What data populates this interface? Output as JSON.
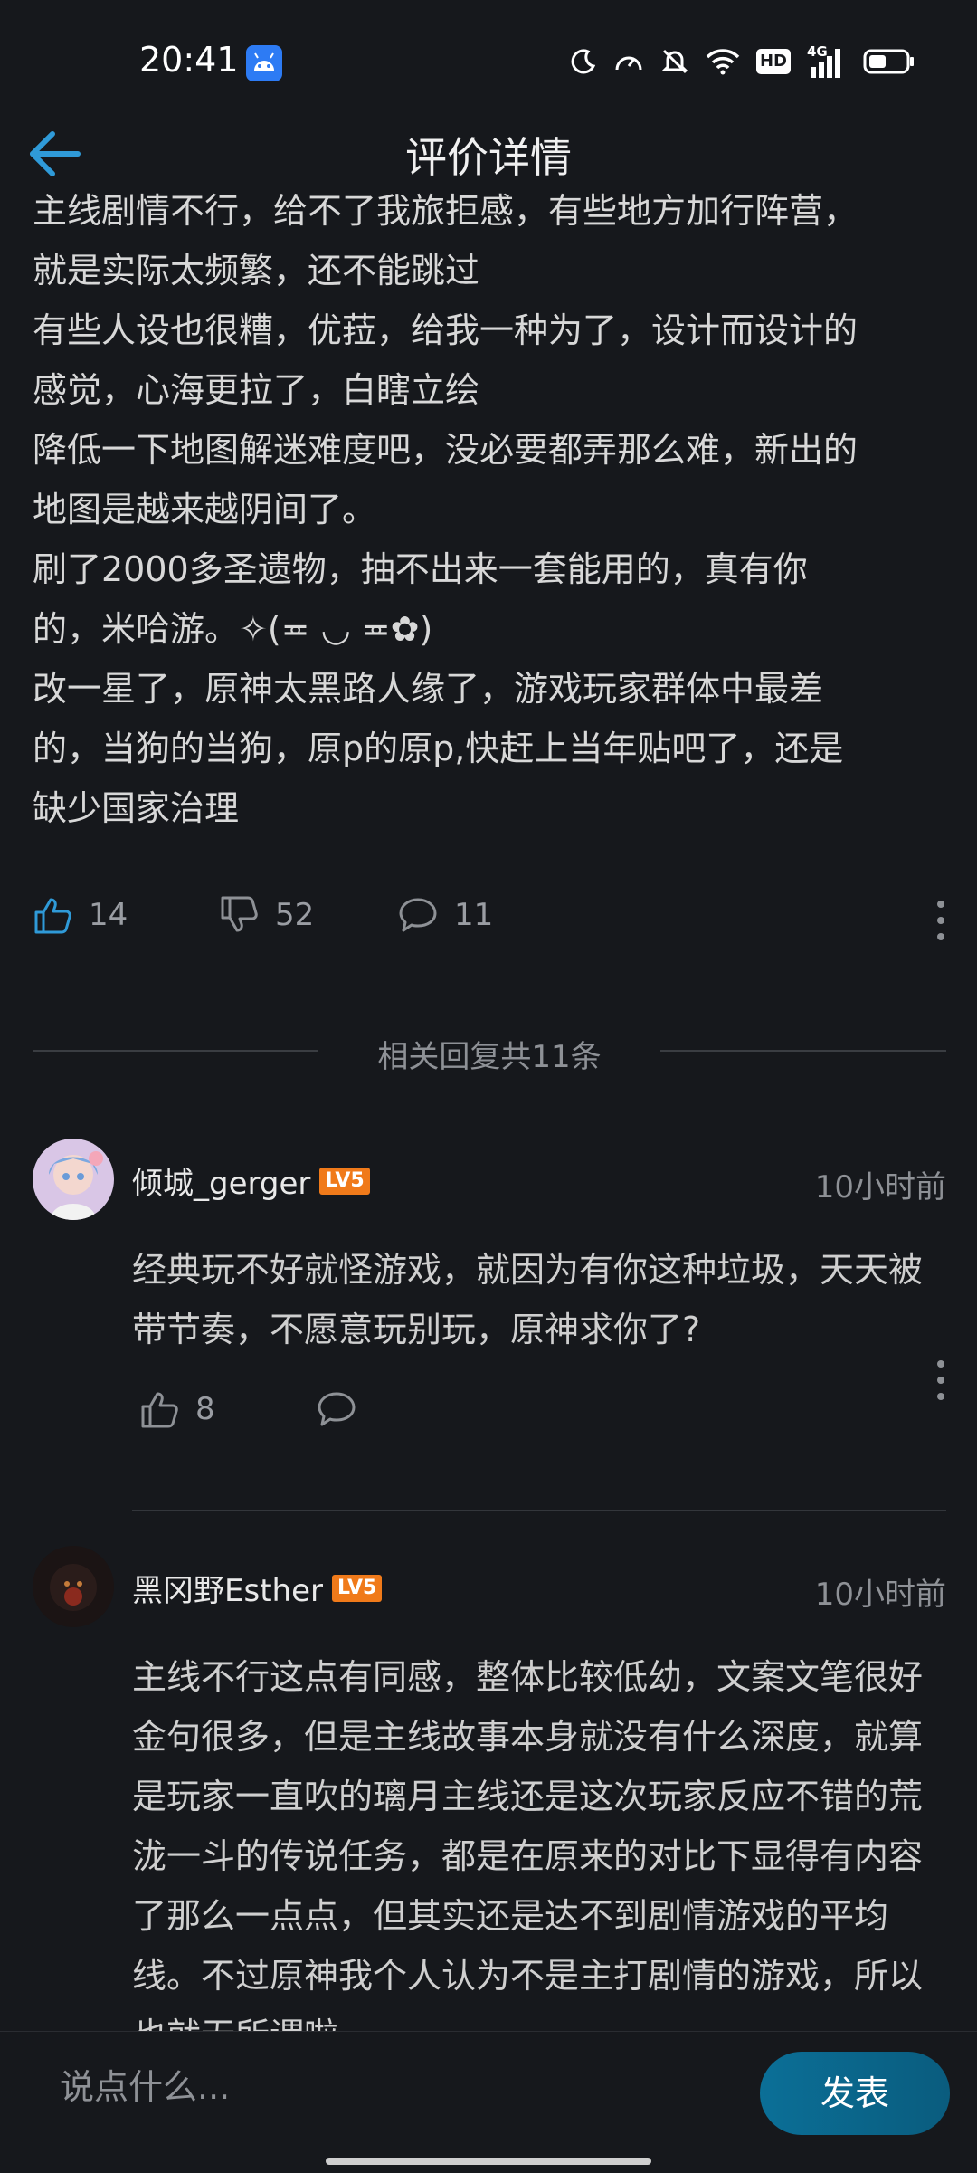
{
  "status": {
    "time": "20:41",
    "network": "4G",
    "hd": "HD"
  },
  "header": {
    "title": "评价详情"
  },
  "review": {
    "lines": [
      "主线剧情不行，给不了我旅拒感，有些地方加行阵营，",
      "就是实际太频繁，还不能跳过",
      "有些人设也很糟，优菈，给我一种为了，设计而设计的",
      "感觉，心海更拉了，白瞎立绘",
      "降低一下地图解迷难度吧，没必要都弄那么难，新出的",
      "地图是越来越阴间了。",
      "刷了2000多圣遗物，抽不出来一套能用的，真有你",
      "的，米哈游。✧(≖ ◡ ≖✿)",
      "改一星了，原神太黑路人缘了，游戏玩家群体中最差",
      "的，当狗的当狗，原p的原p,快赶上当年贴吧了，还是",
      "缺少国家治理"
    ],
    "likes": "14",
    "dislikes": "52",
    "comments": "11"
  },
  "replies": {
    "header": "相关回复共11条",
    "items": [
      {
        "username": "倾城_gerger",
        "level": "LV5",
        "time": "10小时前",
        "text": "经典玩不好就怪游戏，就因为有你这种垃圾，天天被带节奏，不愿意玩别玩，原神求你了?",
        "likes": "8"
      },
      {
        "username": "黑冈野Esther",
        "level": "LV5",
        "time": "10小时前",
        "text": "主线不行这点有同感，整体比较低幼，文案文笔很好金句很多，但是主线故事本身就没有什么深度，就算是玩家一直吹的璃月主线还是这次玩家反应不错的荒泷一斗的传说任务，都是在原来的对比下显得有内容了那么一点点，但其实还是达不到剧情游戏的平均线。不过原神我个人认为不是主打剧情的游戏，所以也就无所谓啦"
      }
    ]
  },
  "composer": {
    "placeholder": "说点什么...",
    "submit": "发表"
  },
  "colors": {
    "accent": "#2f9ad8",
    "background": "#16181c",
    "level_badge": "#f07a1a"
  }
}
